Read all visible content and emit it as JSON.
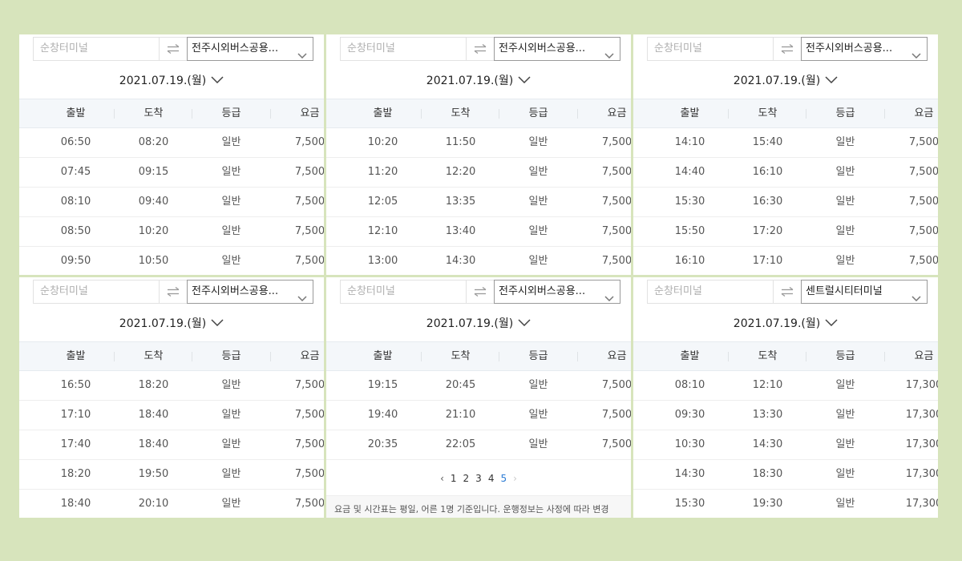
{
  "columns": [
    "출발",
    "도착",
    "등급",
    "요금"
  ],
  "panels": [
    {
      "origin_placeholder": "순창터미널",
      "destination": "전주시외버스공용...",
      "date": "2021.07.19.(월)",
      "rows": [
        [
          "06:50",
          "08:20",
          "일반",
          "7,500"
        ],
        [
          "07:45",
          "09:15",
          "일반",
          "7,500"
        ],
        [
          "08:10",
          "09:40",
          "일반",
          "7,500"
        ],
        [
          "08:50",
          "10:20",
          "일반",
          "7,500"
        ],
        [
          "09:50",
          "10:50",
          "일반",
          "7,500"
        ]
      ]
    },
    {
      "origin_placeholder": "순창터미널",
      "destination": "전주시외버스공용...",
      "date": "2021.07.19.(월)",
      "rows": [
        [
          "10:20",
          "11:50",
          "일반",
          "7,500"
        ],
        [
          "11:20",
          "12:20",
          "일반",
          "7,500"
        ],
        [
          "12:05",
          "13:35",
          "일반",
          "7,500"
        ],
        [
          "12:10",
          "13:40",
          "일반",
          "7,500"
        ],
        [
          "13:00",
          "14:30",
          "일반",
          "7,500"
        ]
      ]
    },
    {
      "origin_placeholder": "순창터미널",
      "destination": "전주시외버스공용...",
      "date": "2021.07.19.(월)",
      "rows": [
        [
          "14:10",
          "15:40",
          "일반",
          "7,500"
        ],
        [
          "14:40",
          "16:10",
          "일반",
          "7,500"
        ],
        [
          "15:30",
          "16:30",
          "일반",
          "7,500"
        ],
        [
          "15:50",
          "17:20",
          "일반",
          "7,500"
        ],
        [
          "16:10",
          "17:10",
          "일반",
          "7,500"
        ]
      ]
    },
    {
      "origin_placeholder": "순창터미널",
      "destination": "전주시외버스공용...",
      "date": "2021.07.19.(월)",
      "rows": [
        [
          "16:50",
          "18:20",
          "일반",
          "7,500"
        ],
        [
          "17:10",
          "18:40",
          "일반",
          "7,500"
        ],
        [
          "17:40",
          "18:40",
          "일반",
          "7,500"
        ],
        [
          "18:20",
          "19:50",
          "일반",
          "7,500"
        ],
        [
          "18:40",
          "20:10",
          "일반",
          "7,500"
        ]
      ]
    },
    {
      "origin_placeholder": "순창터미널",
      "destination": "전주시외버스공용...",
      "date": "2021.07.19.(월)",
      "rows": [
        [
          "19:15",
          "20:45",
          "일반",
          "7,500"
        ],
        [
          "19:40",
          "21:10",
          "일반",
          "7,500"
        ],
        [
          "20:35",
          "22:05",
          "일반",
          "7,500"
        ]
      ],
      "pagination": {
        "prev": "‹",
        "pages": [
          "1",
          "2",
          "3",
          "4",
          "5"
        ],
        "current": "5",
        "next": "›"
      },
      "notice": "요금 및 시간표는 평일, 어른 1명 기준입니다. 운행정보는 사정에 따라 변경"
    },
    {
      "origin_placeholder": "순창터미널",
      "destination": "센트럴시티터미널",
      "date": "2021.07.19.(월)",
      "rows": [
        [
          "08:10",
          "12:10",
          "일반",
          "17,300"
        ],
        [
          "09:30",
          "13:30",
          "일반",
          "17,300"
        ],
        [
          "10:30",
          "14:30",
          "일반",
          "17,300"
        ],
        [
          "14:30",
          "18:30",
          "일반",
          "17,300"
        ],
        [
          "15:30",
          "19:30",
          "일반",
          "17,300"
        ]
      ]
    }
  ]
}
